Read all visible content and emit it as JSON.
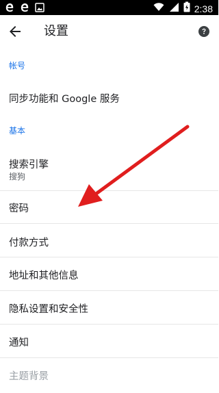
{
  "statusbar": {
    "time": "2:38"
  },
  "header": {
    "title": "设置"
  },
  "sections": {
    "account": {
      "header": "帐号",
      "items": [
        {
          "label": "同步功能和 Google 服务"
        }
      ]
    },
    "basic": {
      "header": "基本",
      "items": [
        {
          "label": "搜索引擎",
          "sub": "搜狗"
        },
        {
          "label": "密码"
        },
        {
          "label": "付款方式"
        },
        {
          "label": "地址和其他信息"
        },
        {
          "label": "隐私设置和安全性"
        },
        {
          "label": "通知"
        },
        {
          "label": "主题背景"
        }
      ]
    }
  },
  "icons": {
    "back": "arrow-back-icon",
    "help": "help-icon",
    "wifi": "wifi-icon",
    "signal": "signal-icon",
    "battery": "battery-icon"
  },
  "colors": {
    "accent": "#1a73e8",
    "annotation_arrow": "#e01e1e"
  }
}
